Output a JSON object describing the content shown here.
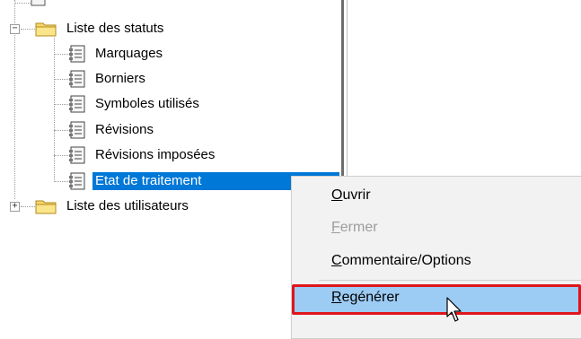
{
  "tree": {
    "root": {
      "label": "Liste des statuts",
      "expander": "−",
      "icon": "folder-icon"
    },
    "children": [
      {
        "label": "Marquages",
        "icon": "document-list-icon"
      },
      {
        "label": "Borniers",
        "icon": "document-list-icon"
      },
      {
        "label": "Symboles utilisés",
        "icon": "document-list-icon"
      },
      {
        "label": "Révisions",
        "icon": "document-list-icon"
      },
      {
        "label": "Révisions imposées",
        "icon": "document-list-icon"
      },
      {
        "label": "Etat de traitement",
        "icon": "document-list-icon",
        "selected": true
      }
    ],
    "sibling": {
      "label": "Liste des utilisateurs",
      "expander": "+",
      "icon": "folder-icon"
    }
  },
  "context_menu": {
    "items": [
      {
        "mnemonic": "O",
        "rest": "uvrir",
        "enabled": true
      },
      {
        "mnemonic": "F",
        "rest": "ermer",
        "enabled": false
      },
      {
        "mnemonic": "C",
        "rest": "ommentaire/Options",
        "enabled": true
      },
      {
        "mnemonic": "R",
        "rest": "egénérer",
        "enabled": true,
        "highlighted": true
      }
    ]
  },
  "colors": {
    "selection": "#0078d7",
    "menu_background": "#f2f2f2",
    "menu_hover": "#9ccbf3",
    "highlight_border": "#e0151b",
    "folder": "#f5d76e"
  },
  "cursor": "arrow-cursor-icon"
}
